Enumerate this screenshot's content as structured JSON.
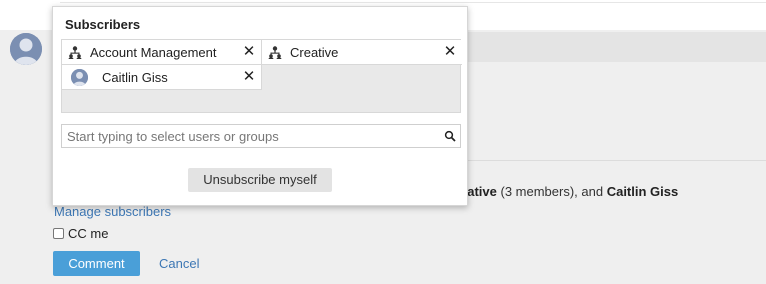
{
  "popover": {
    "title": "Subscribers",
    "chips": [
      {
        "label": "Account Management",
        "type": "group",
        "close": "✕"
      },
      {
        "label": "Creative",
        "type": "group",
        "close": "✕"
      },
      {
        "label": "Caitlin Giss",
        "type": "user",
        "close": "✕"
      }
    ],
    "search": {
      "placeholder": "Start typing to select users or groups",
      "value": ""
    },
    "unsubscribe_label": "Unsubscribe myself"
  },
  "comment": {
    "subscribers_text": {
      "part1": "eative",
      "part2": " (3 members),  and ",
      "part3": "Caitlin Giss"
    },
    "manage_label": "Manage subscribers",
    "cc_label": "CC me",
    "cc_checked": false,
    "comment_button": "Comment",
    "cancel_label": "Cancel"
  },
  "colors": {
    "accent": "#4a9fd8",
    "link": "#3d77b4",
    "panel_bg": "#efefef",
    "chip_area_bg": "#e9e9e9"
  },
  "icons": {
    "group": "group-hierarchy-icon",
    "close": "close-icon",
    "search": "search-icon",
    "avatar": "avatar"
  }
}
